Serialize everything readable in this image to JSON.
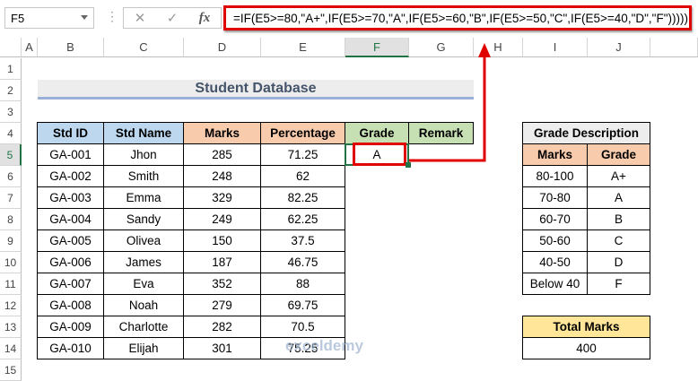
{
  "name_box": "F5",
  "formula": "=IF(E5>=80,\"A+\",IF(E5>=70,\"A\",IF(E5>=60,\"B\",IF(E5>=50,\"C\",IF(E5>=40,\"D\",\"F\")))))",
  "columns": [
    "A",
    "B",
    "C",
    "D",
    "E",
    "F",
    "G",
    "H",
    "I",
    "J"
  ],
  "rows": [
    "1",
    "2",
    "3",
    "4",
    "5",
    "6",
    "7",
    "8",
    "9",
    "10",
    "11",
    "12",
    "13",
    "14",
    "15"
  ],
  "title": "Student Database",
  "headers": [
    "Std ID",
    "Std Name",
    "Marks",
    "Percentage",
    "Grade",
    "Remark"
  ],
  "students": [
    {
      "id": "GA-001",
      "name": "Jhon",
      "marks": "285",
      "pct": "71.25",
      "grade": "A"
    },
    {
      "id": "GA-002",
      "name": "Smith",
      "marks": "248",
      "pct": "62"
    },
    {
      "id": "GA-003",
      "name": "Emma",
      "marks": "329",
      "pct": "82.25"
    },
    {
      "id": "GA-004",
      "name": "Sandy",
      "marks": "249",
      "pct": "62.25"
    },
    {
      "id": "GA-005",
      "name": "Olivea",
      "marks": "150",
      "pct": "37.5"
    },
    {
      "id": "GA-006",
      "name": "James",
      "marks": "187",
      "pct": "46.75"
    },
    {
      "id": "GA-007",
      "name": "Eva",
      "marks": "352",
      "pct": "88"
    },
    {
      "id": "GA-008",
      "name": "Noah",
      "marks": "279",
      "pct": "69.75"
    },
    {
      "id": "GA-009",
      "name": "Charlotte",
      "marks": "282",
      "pct": "70.5"
    },
    {
      "id": "GA-010",
      "name": "Elijah",
      "marks": "301",
      "pct": "75.25"
    }
  ],
  "grade_desc": {
    "title": "Grade Description",
    "headers": [
      "Marks",
      "Grade"
    ],
    "rows": [
      [
        "80-100",
        "A+"
      ],
      [
        "70-80",
        "A"
      ],
      [
        "60-70",
        "B"
      ],
      [
        "50-60",
        "C"
      ],
      [
        "40-50",
        "D"
      ],
      [
        "Below 40",
        "F"
      ]
    ]
  },
  "total": {
    "label": "Total Marks",
    "value": "400"
  },
  "watermark": "exceldemy EXCEL · DATA · BI",
  "colors": {
    "blue": "#bdd7ee",
    "orange": "#f8cbad",
    "green": "#c6e0b4",
    "yellow": "#ffe699",
    "highlight": "#e00000"
  }
}
